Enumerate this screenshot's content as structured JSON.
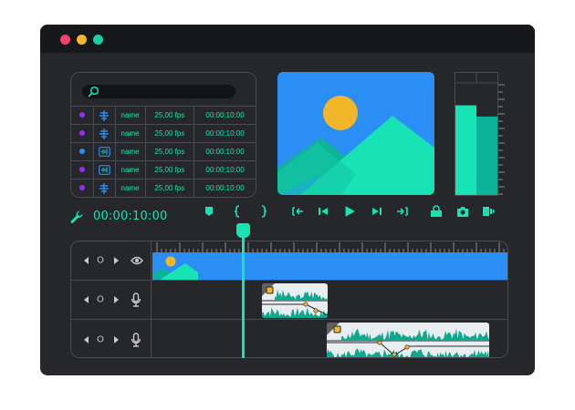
{
  "window": {
    "controls": [
      {
        "name": "close",
        "color": "#f2416b"
      },
      {
        "name": "minimize",
        "color": "#f2b62b"
      },
      {
        "name": "maximize",
        "color": "#18d0a4"
      }
    ]
  },
  "media_panel": {
    "search": {
      "placeholder": "",
      "icon": "search-icon"
    },
    "items": [
      {
        "dot_color": "#9b2cf5",
        "icon": "video-clip-icon",
        "name": "name",
        "fps": "25,00 fps",
        "duration": "00:00:10:00"
      },
      {
        "dot_color": "#9b2cf5",
        "icon": "video-clip-icon",
        "name": "name",
        "fps": "25,00 fps",
        "duration": "00:00:10:00"
      },
      {
        "dot_color": "#2a8ef4",
        "icon": "audio-clip-icon",
        "name": "name",
        "fps": "25,00 fps",
        "duration": "00:00:10:00"
      },
      {
        "dot_color": "#9b2cf5",
        "icon": "audio-clip-icon",
        "name": "name",
        "fps": "25,00 fps",
        "duration": "00:00:10:00"
      },
      {
        "dot_color": "#9b2cf5",
        "icon": "video-clip-icon",
        "name": "name",
        "fps": "25,00 fps",
        "duration": "00:00:10:00"
      }
    ]
  },
  "preview": {
    "icon": "image-landscape-icon"
  },
  "audio_meter": {
    "left_level": 0.8,
    "right_level": 0.7
  },
  "transport": {
    "timecode": "00:00:10:00",
    "tools_icon": "wrench-icon",
    "buttons": [
      "marker-icon",
      "mark-in-icon",
      "mark-out-icon",
      "go-to-in-icon",
      "step-back-icon",
      "play-icon",
      "step-forward-icon",
      "go-to-out-icon",
      "lock-export-icon",
      "camera-icon",
      "clip-settings-icon"
    ]
  },
  "timeline": {
    "tracks": [
      {
        "type": "video",
        "icon": "eye-icon",
        "counter": "O"
      },
      {
        "type": "audio",
        "icon": "microphone-icon",
        "counter": "O"
      },
      {
        "type": "audio",
        "icon": "microphone-icon",
        "counter": "O"
      }
    ],
    "colors": {
      "accent": "#18e3b4",
      "video": "#2a8ef4",
      "clip_bg": "#e8eef0"
    }
  }
}
